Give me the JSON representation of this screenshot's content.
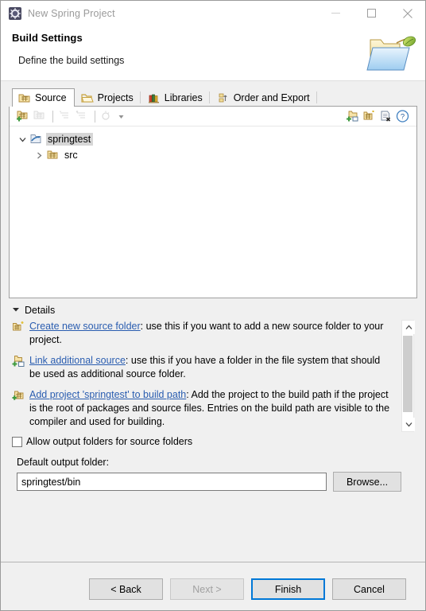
{
  "window": {
    "title": "New Spring Project",
    "title_icon": "spring-gear-icon",
    "controls": {
      "minimize": "minimize-icon",
      "maximize": "maximize-icon",
      "close": "close-icon"
    }
  },
  "header": {
    "title": "Build Settings",
    "subtitle": "Define the build settings",
    "icon": "folder-leaf-icon"
  },
  "tabs": [
    {
      "label": "Source",
      "icon": "source-folder-icon",
      "active": true
    },
    {
      "label": "Projects",
      "icon": "open-folder-icon",
      "active": false
    },
    {
      "label": "Libraries",
      "icon": "books-icon",
      "active": false
    },
    {
      "label": "Order and Export",
      "icon": "order-export-icon",
      "active": false
    }
  ],
  "toolbar": {
    "buttons": [
      {
        "name": "add-folder-icon",
        "enabled": true
      },
      {
        "name": "link-source-icon",
        "enabled": false
      },
      {
        "name": "edit-filters-icon",
        "enabled": false
      },
      {
        "name": "remove-filters-icon",
        "enabled": false
      },
      {
        "name": "configure-icon",
        "enabled": false
      },
      {
        "name": "configure-dropdown-caret-icon",
        "enabled": false
      }
    ],
    "right_buttons": [
      {
        "name": "link-additional-source-icon"
      },
      {
        "name": "create-new-source-folder-icon"
      },
      {
        "name": "remove-entry-icon"
      },
      {
        "name": "help-icon"
      }
    ]
  },
  "tree": {
    "nodes": [
      {
        "label": "springtest",
        "icon": "project-icon",
        "expanded": true,
        "selected": true,
        "indent": 0
      },
      {
        "label": "src",
        "icon": "source-folder-icon",
        "expanded": false,
        "selected": false,
        "indent": 1
      }
    ]
  },
  "details": {
    "heading": "Details",
    "expanded": true,
    "items": [
      {
        "icon": "create-new-source-folder-icon",
        "link": "Create new source folder",
        "text": ": use this if you want to add a new source folder to your project."
      },
      {
        "icon": "link-additional-source-icon",
        "link": "Link additional source",
        "text": ": use this if you have a folder in the file system that should be used as additional source folder."
      },
      {
        "icon": "add-project-to-build-path-icon",
        "link": "Add project 'springtest' to build path",
        "text": ": Add the project to the build path if the project is the root of packages and source files. Entries on the build path are visible to the compiler and used for building."
      }
    ]
  },
  "allow_output_folders": {
    "label": "Allow output folders for source folders",
    "checked": false
  },
  "output_folder": {
    "label": "Default output folder:",
    "value": "springtest/bin",
    "placeholder": "",
    "browse_label": "Browse..."
  },
  "footer": {
    "back_label": "< Back",
    "next_label": "Next >",
    "finish_label": "Finish",
    "cancel_label": "Cancel",
    "next_enabled": false,
    "finish_is_default": true
  },
  "colors": {
    "accent": "#0078d7",
    "link": "#2a5db0",
    "window_bg": "#f0f0f0",
    "panel_bg": "#ffffff",
    "selection": "#d6d6d6"
  }
}
